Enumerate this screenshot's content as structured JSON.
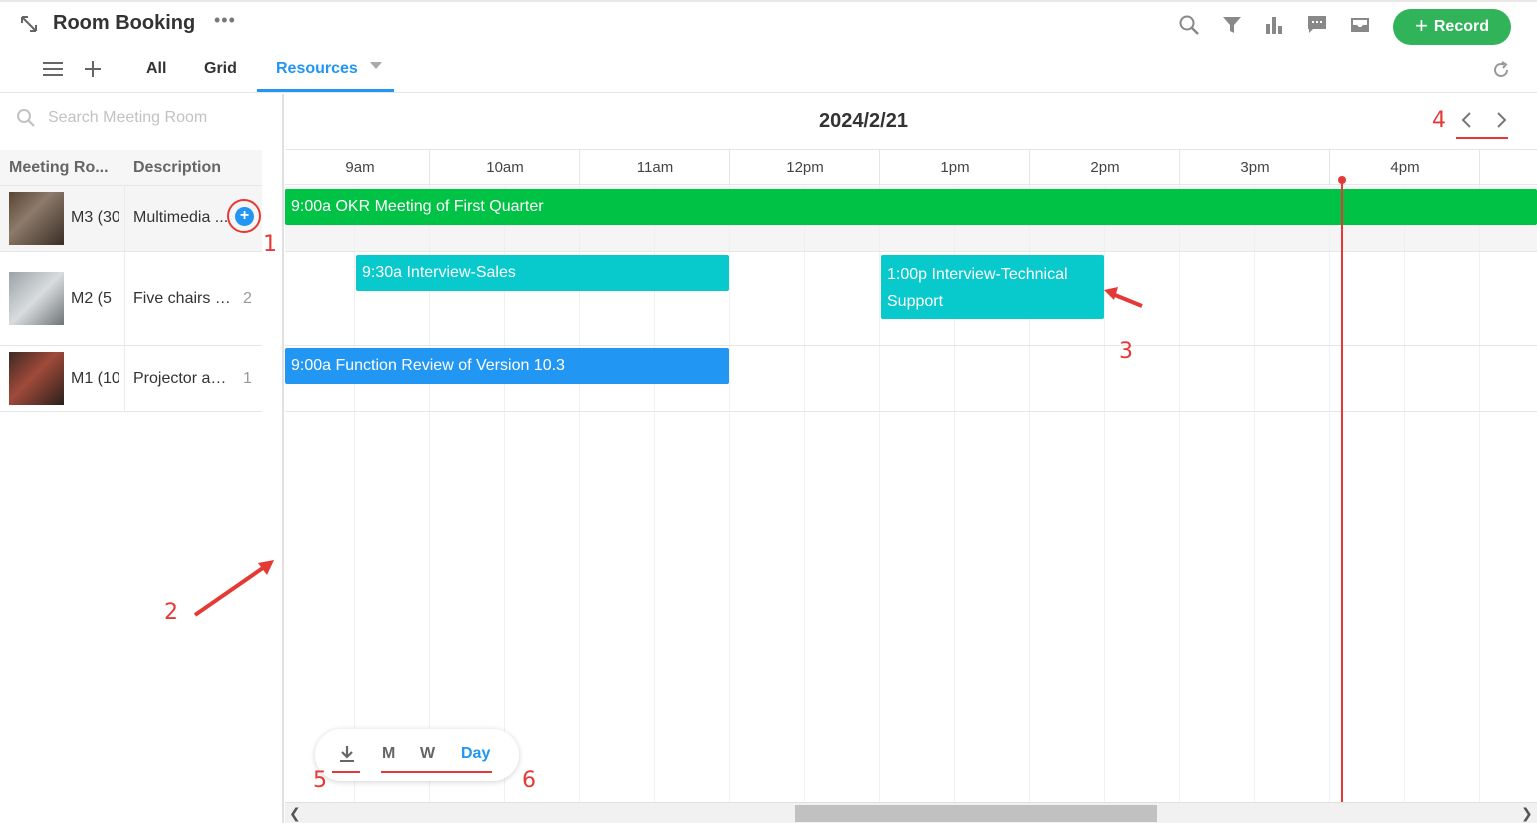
{
  "header": {
    "title": "Room Booking",
    "more": "•••",
    "record_label": "Record"
  },
  "tabs": [
    {
      "label": "All"
    },
    {
      "label": "Grid"
    },
    {
      "label": "Resources"
    }
  ],
  "search": {
    "placeholder": "Search Meeting Room"
  },
  "resources_table": {
    "columns": [
      "Meeting Ro...",
      "Description"
    ],
    "rows": [
      {
        "name": "M3 (30",
        "desc": "Multimedia ...",
        "count": ""
      },
      {
        "name": "M2 (5",
        "desc": "Five chairs a...",
        "count": "2"
      },
      {
        "name": "M1 (10",
        "desc": "Projector ava...",
        "count": "1"
      }
    ]
  },
  "timeline": {
    "date": "2024/2/21",
    "hours": [
      "9am",
      "10am",
      "11am",
      "12pm",
      "1pm",
      "2pm",
      "3pm",
      "4pm"
    ],
    "events": [
      {
        "text": "9:00a OKR Meeting of First Quarter",
        "color": "#00c244"
      },
      {
        "text": "9:30a Interview-Sales",
        "color": "#08c9cc"
      },
      {
        "text": "1:00p Interview-Technical Support",
        "color": "#08c9cc"
      },
      {
        "text": "9:00a Function Review of Version 10.3",
        "color": "#2196f3"
      }
    ]
  },
  "view_switcher": {
    "month": "M",
    "week": "W",
    "day": "Day"
  },
  "annotations": [
    "1",
    "2",
    "3",
    "4",
    "5",
    "6"
  ],
  "colors": {
    "accent": "#2196f3",
    "record": "#31b459",
    "now_line": "#e53935"
  }
}
